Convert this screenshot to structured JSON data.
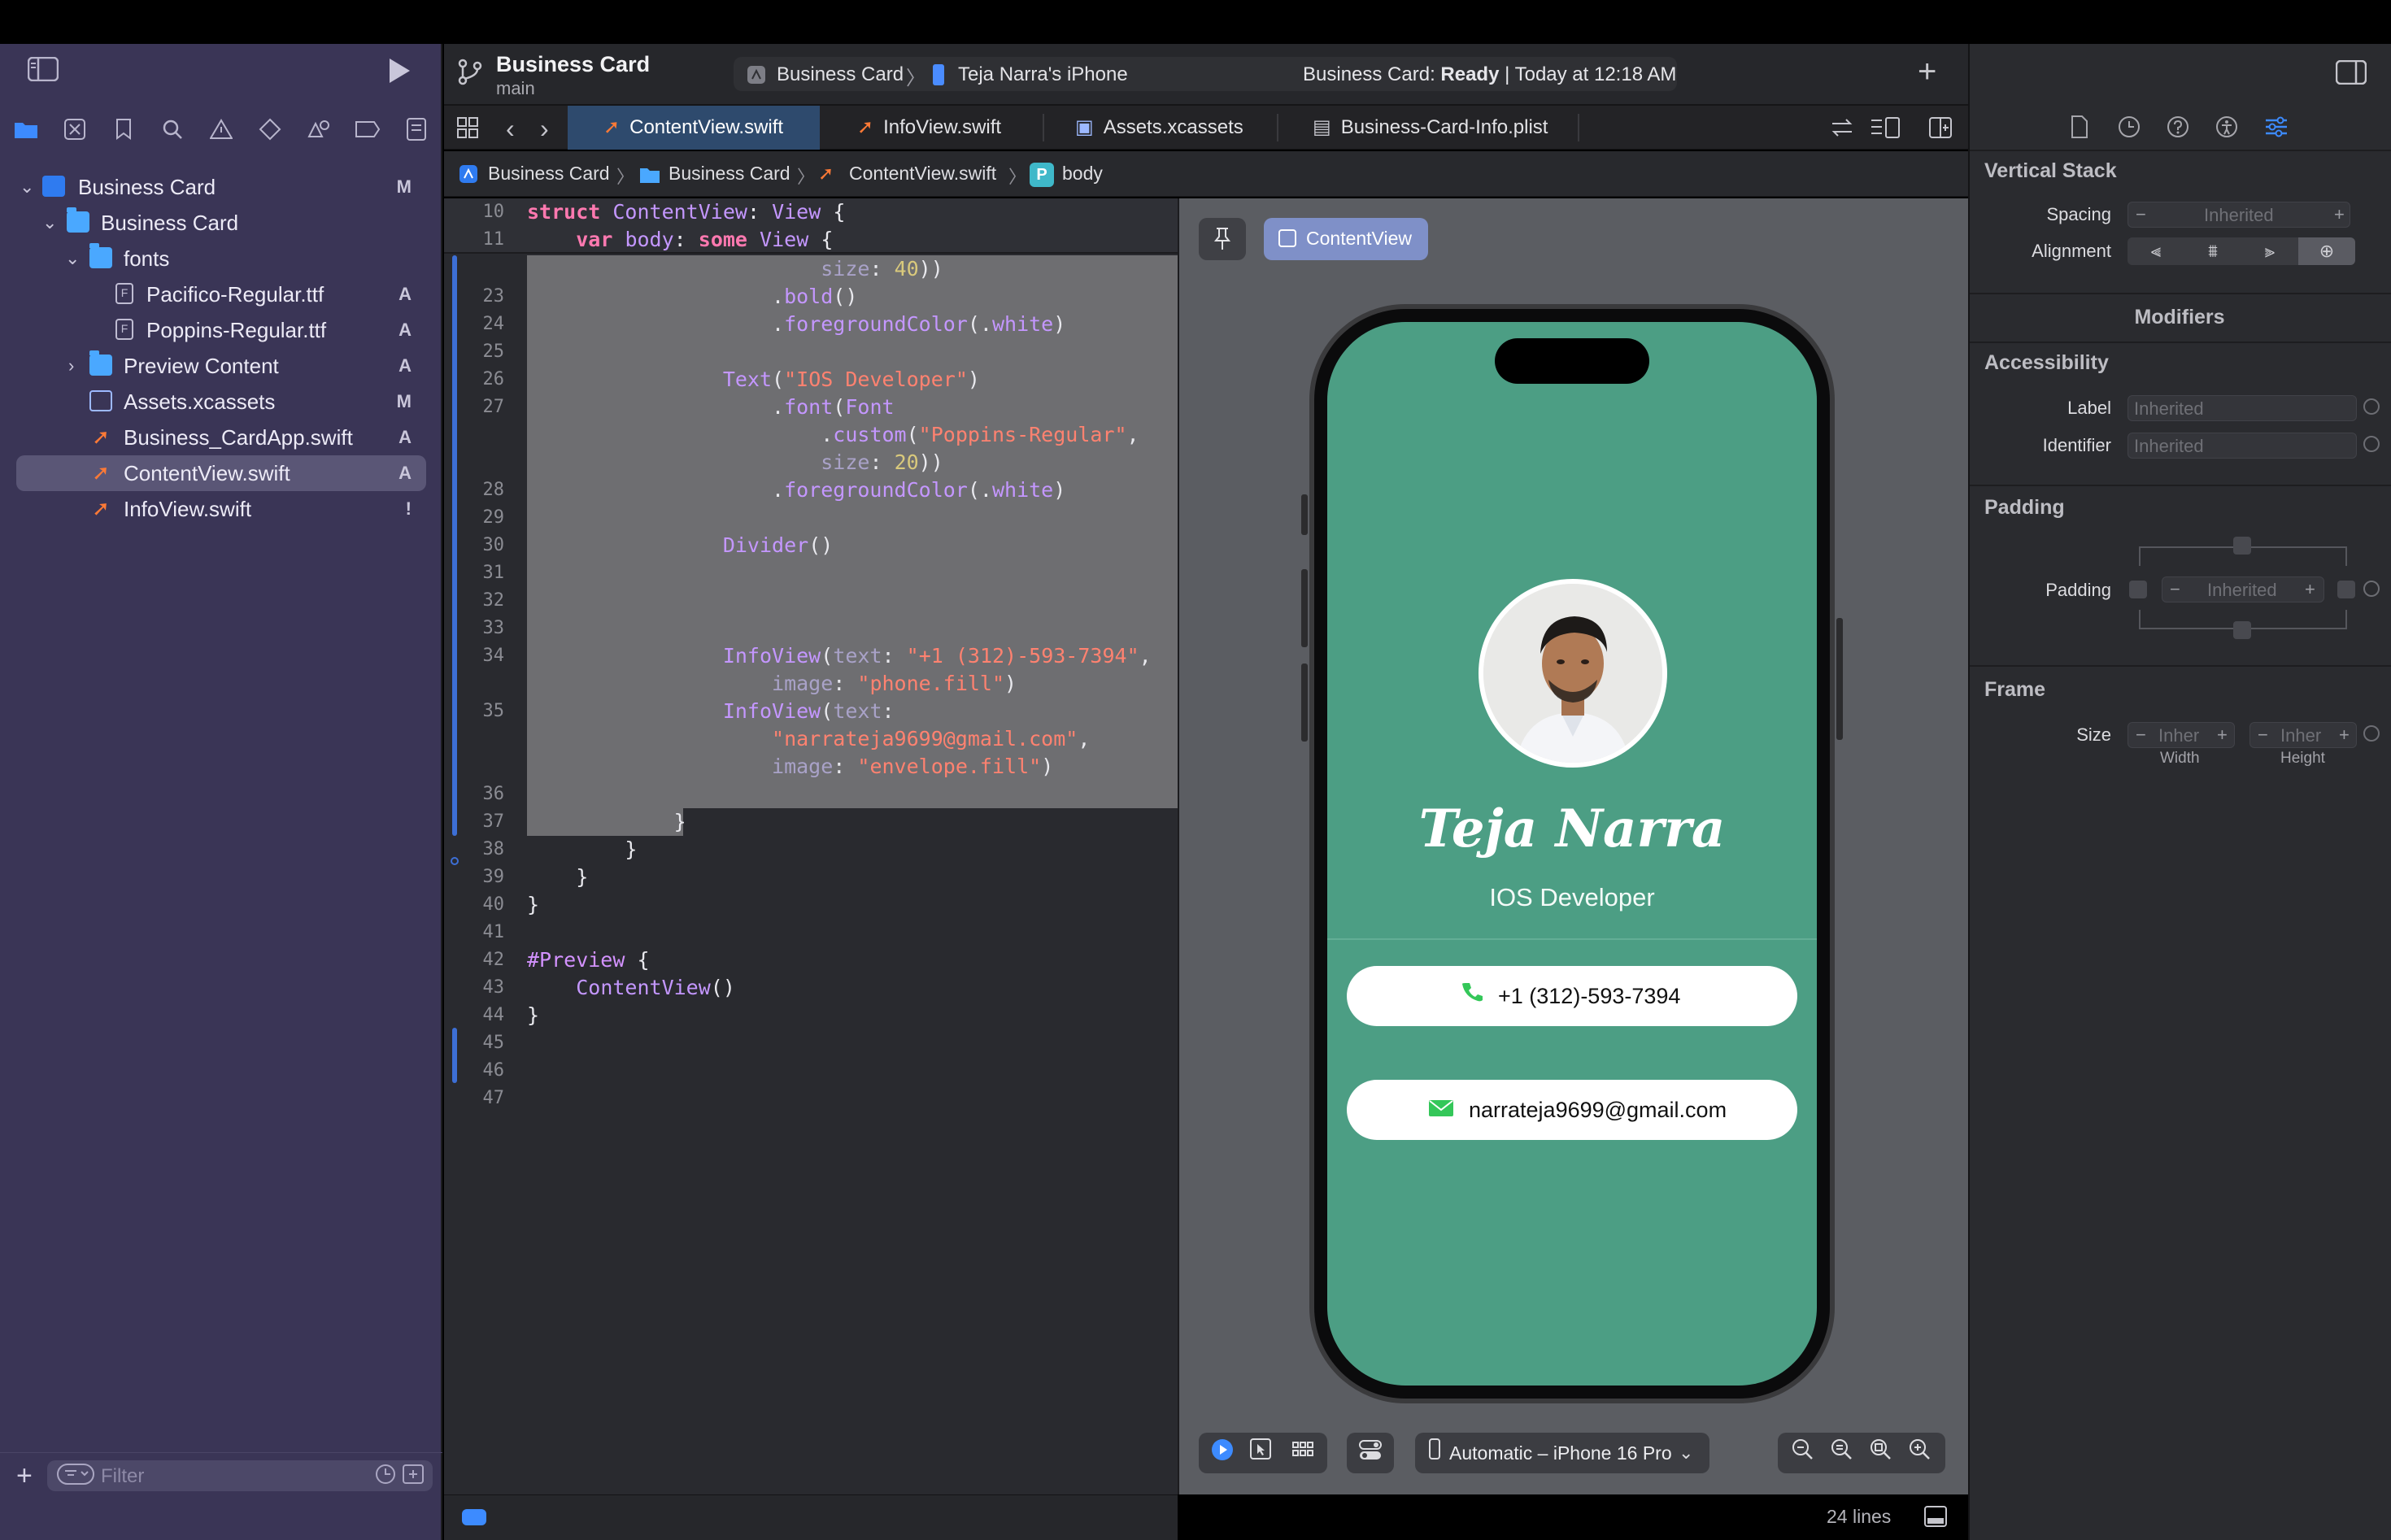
{
  "navigator": {
    "tree": [
      {
        "label": "Business Card",
        "badge": "M"
      },
      {
        "label": "Business Card",
        "badge": ""
      },
      {
        "label": "fonts",
        "badge": ""
      },
      {
        "label": "Pacifico-Regular.ttf",
        "badge": "A"
      },
      {
        "label": "Poppins-Regular.ttf",
        "badge": "A"
      },
      {
        "label": "Preview Content",
        "badge": "A"
      },
      {
        "label": "Assets.xcassets",
        "badge": "M"
      },
      {
        "label": "Business_CardApp.swift",
        "badge": "A"
      },
      {
        "label": "ContentView.swift",
        "badge": "A"
      },
      {
        "label": "InfoView.swift",
        "badge": "!"
      }
    ],
    "filter_placeholder": "Filter"
  },
  "toolbar": {
    "project_title": "Business Card",
    "branch": "main",
    "scheme": "Business Card",
    "device": "Teja Narra's iPhone",
    "status_prefix": "Business Card: ",
    "status_state": "Ready",
    "status_suffix": " | Today at 12:18 AM"
  },
  "tabs": [
    {
      "label": "ContentView.swift",
      "icon": "swift-icon",
      "active": true
    },
    {
      "label": "InfoView.swift",
      "icon": "swift-icon",
      "active": false
    },
    {
      "label": "Assets.xcassets",
      "icon": "assets-icon",
      "active": false
    },
    {
      "label": "Business-Card-Info.plist",
      "icon": "plist-icon",
      "active": false
    }
  ],
  "jumpbar": [
    "Business Card",
    "Business Card",
    "ContentView.swift",
    "body"
  ],
  "jumpbar_symbol_badge": "P",
  "editor": {
    "line_numbers": [
      "10",
      "11",
      "23",
      "24",
      "25",
      "26",
      "27",
      "28",
      "29",
      "30",
      "31",
      "32",
      "33",
      "34",
      "35",
      "36",
      "37",
      "38",
      "39",
      "40",
      "41",
      "42",
      "43",
      "44",
      "45",
      "46",
      "47"
    ],
    "lines_count": "24 lines"
  },
  "preview": {
    "chip_label": "ContentView",
    "name": "Teja Narra",
    "role": "IOS Developer",
    "phone": "+1 (312)-593-7394",
    "email": "narrateja9699@gmail.com",
    "device_picker": "Automatic – iPhone 16 Pro"
  },
  "inspector": {
    "section_title": "Vertical Stack",
    "spacing_label": "Spacing",
    "spacing_value": "Inherited",
    "alignment_label": "Alignment",
    "modifiers_title": "Modifiers",
    "accessibility_title": "Accessibility",
    "label_label": "Label",
    "label_value": "Inherited",
    "identifier_label": "Identifier",
    "identifier_value": "Inherited",
    "padding_title": "Padding",
    "padding_label": "Padding",
    "padding_value": "Inherited",
    "frame_title": "Frame",
    "size_label": "Size",
    "width_value": "Inher",
    "height_value": "Inher",
    "width_caption": "Width",
    "height_caption": "Height"
  },
  "colors": {
    "card_background": "#4c9e84",
    "accent": "#3d8bff",
    "swift_orange": "#ff7a36"
  }
}
